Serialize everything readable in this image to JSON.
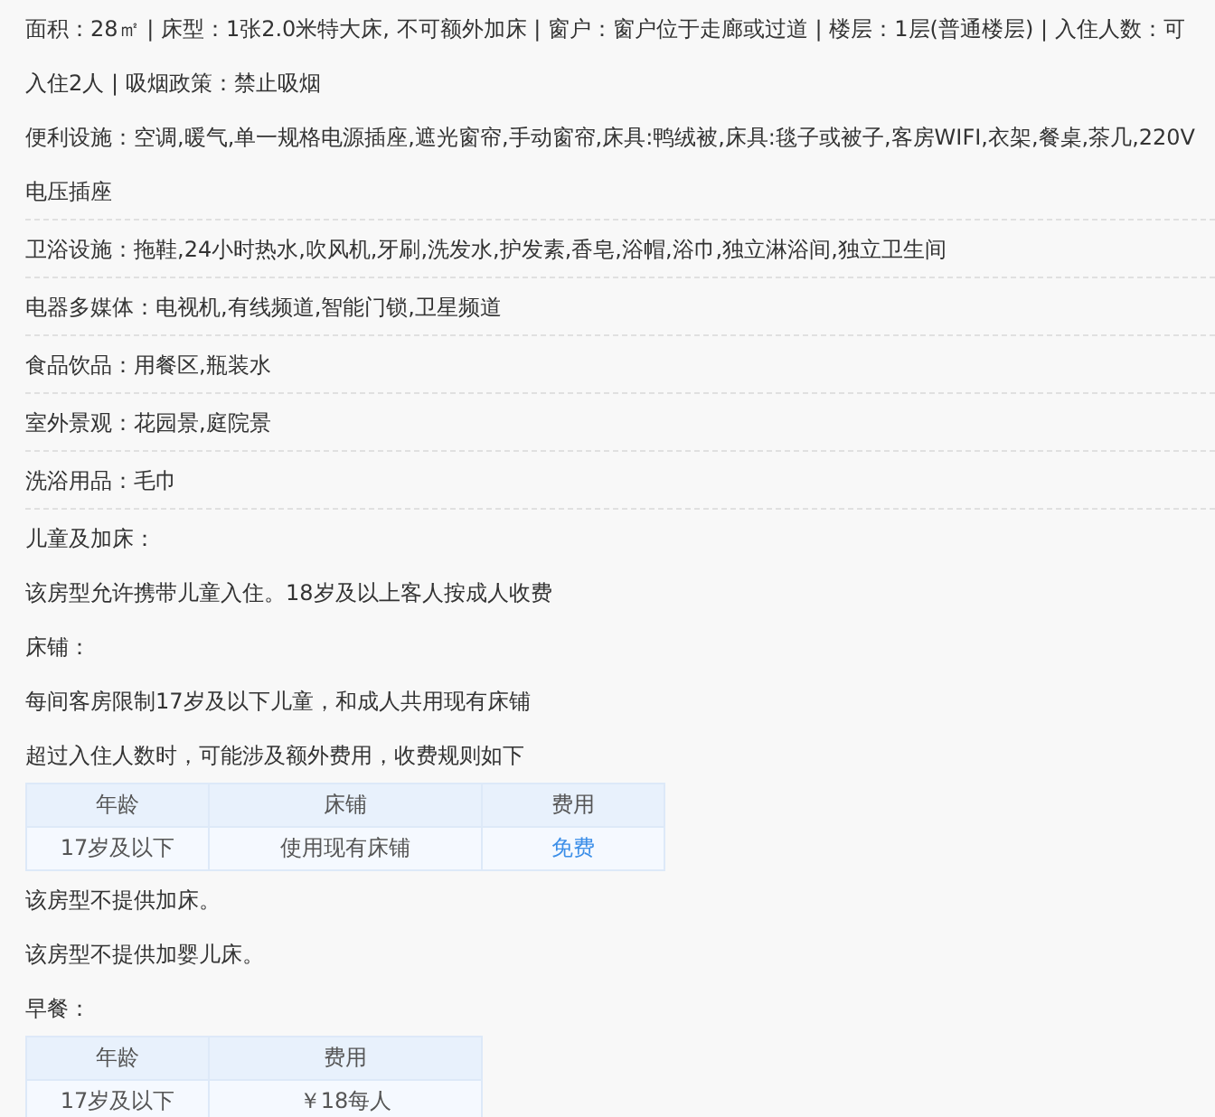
{
  "room_info": "面积：28㎡ | 床型：1张2.0米特大床, 不可额外加床 | 窗户：窗户位于走廊或过道 | 楼层：1层(普通楼层) | 入住人数：可入住2人 | 吸烟政策：禁止吸烟",
  "facilities": [
    "便利设施：空调,暖气,单一规格电源插座,遮光窗帘,手动窗帘,床具:鸭绒被,床具:毯子或被子,客房WIFI,衣架,餐桌,茶几,220V电压插座",
    "卫浴设施：拖鞋,24小时热水,吹风机,牙刷,洗发水,护发素,香皂,浴帽,浴巾,独立淋浴间,独立卫生间",
    "电器多媒体：电视机,有线频道,智能门锁,卫星频道",
    "食品饮品：用餐区,瓶装水",
    "室外景观：花园景,庭院景",
    "洗浴用品：毛巾"
  ],
  "policies": [
    {
      "kind": "text",
      "text": "儿童及加床："
    },
    {
      "kind": "text",
      "text": "该房型允许携带儿童入住。18岁及以上客人按成人收费"
    },
    {
      "kind": "text",
      "text": "床铺："
    },
    {
      "kind": "text",
      "text": "每间客房限制17岁及以下儿童，和成人共用现有床铺"
    },
    {
      "kind": "text",
      "text": "超过入住人数时，可能涉及额外费用，收费规则如下"
    },
    {
      "kind": "table",
      "columns": [
        "年龄",
        "床铺",
        "费用"
      ],
      "rows": [
        [
          {
            "text": "17岁及以下",
            "emphasized": false
          },
          {
            "text": "使用现有床铺",
            "emphasized": false
          },
          {
            "text": "免费",
            "emphasized": true
          }
        ]
      ]
    },
    {
      "kind": "text",
      "text": "该房型不提供加床。"
    },
    {
      "kind": "text",
      "text": "该房型不提供加婴儿床。"
    },
    {
      "kind": "text",
      "text": "早餐："
    },
    {
      "kind": "table",
      "columns": [
        "年龄",
        "费用"
      ],
      "rows": [
        [
          {
            "text": "17岁及以下",
            "emphasized": false
          },
          {
            "text": "￥18每人",
            "emphasized": false
          }
        ]
      ]
    }
  ]
}
